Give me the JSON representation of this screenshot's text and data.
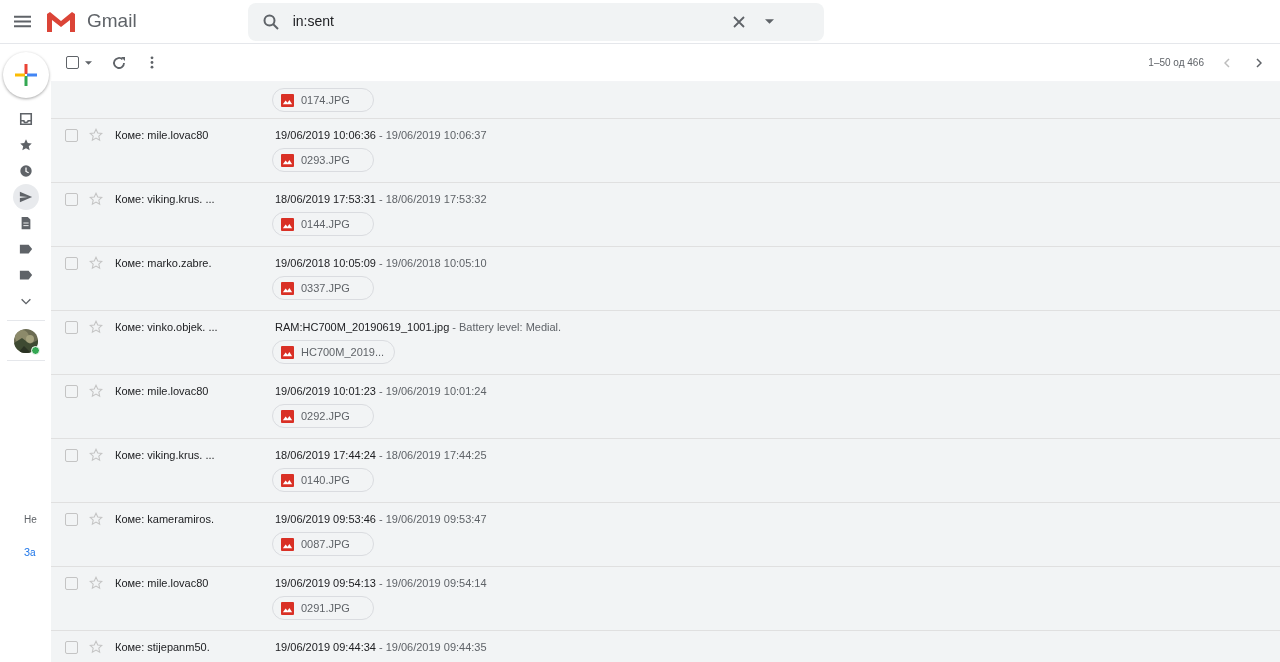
{
  "header": {
    "app_name": "Gmail",
    "search": {
      "value": "in:sent"
    }
  },
  "toolbar": {
    "select_all_checked": false,
    "pagination": "1–50 од 466"
  },
  "sidebar": {
    "nav": [
      {
        "kind": "inbox",
        "selected": false
      },
      {
        "kind": "star",
        "selected": false
      },
      {
        "kind": "clock",
        "selected": false
      },
      {
        "kind": "send",
        "selected": true
      },
      {
        "kind": "file",
        "selected": false
      },
      {
        "kind": "label",
        "selected": false
      },
      {
        "kind": "label",
        "selected": false
      },
      {
        "kind": "more",
        "selected": false
      }
    ],
    "cut_texts": [
      {
        "text": "Не",
        "kind": "plain"
      },
      {
        "text": "За",
        "kind": "link"
      }
    ]
  },
  "messages": [
    {
      "partial": true,
      "attachment": "0174.JPG"
    },
    {
      "checked": false,
      "starred": false,
      "recipient": "Коме: mile.lovac80",
      "subject": "19/06/2019 10:06:36",
      "snippet": "- 19/06/2019 10:06:37",
      "attachment": "0293.JPG"
    },
    {
      "checked": false,
      "starred": false,
      "recipient": "Коме: viking.krus. ...",
      "subject": "18/06/2019 17:53:31",
      "snippet": "- 18/06/2019 17:53:32",
      "attachment": "0144.JPG"
    },
    {
      "checked": false,
      "starred": false,
      "recipient": "Коме: marko.zabre.",
      "subject": "19/06/2018 10:05:09",
      "snippet": "- 19/06/2018 10:05:10",
      "attachment": "0337.JPG"
    },
    {
      "checked": false,
      "starred": false,
      "recipient": "Коме: vinko.objek. ...",
      "subject": "RAM:HC700M_20190619_1001.jpg",
      "snippet": "- Battery level: Medial.",
      "attachment": "HC700M_2019..."
    },
    {
      "checked": false,
      "starred": false,
      "recipient": "Коме: mile.lovac80",
      "subject": "19/06/2019 10:01:23",
      "snippet": "- 19/06/2019 10:01:24",
      "attachment": "0292.JPG"
    },
    {
      "checked": false,
      "starred": false,
      "recipient": "Коме: viking.krus. ...",
      "subject": "18/06/2019 17:44:24",
      "snippet": "- 18/06/2019 17:44:25",
      "attachment": "0140.JPG"
    },
    {
      "checked": false,
      "starred": false,
      "recipient": "Коме: kameramiros.",
      "subject": "19/06/2019 09:53:46",
      "snippet": "- 19/06/2019 09:53:47",
      "attachment": "0087.JPG"
    },
    {
      "checked": false,
      "starred": false,
      "recipient": "Коме: mile.lovac80",
      "subject": "19/06/2019 09:54:13",
      "snippet": "- 19/06/2019 09:54:14",
      "attachment": "0291.JPG"
    },
    {
      "checked": false,
      "starred": false,
      "recipient": "Коме: stijepanm50.",
      "subject": "19/06/2019 09:44:34",
      "snippet": "- 19/06/2019 09:44:35"
    }
  ]
}
